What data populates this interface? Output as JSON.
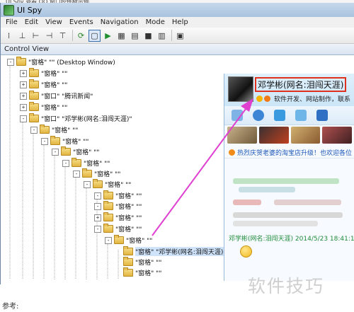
{
  "top_text": "…UI Spy 查看 QQ 窗口控件树示例",
  "window": {
    "title": "UI Spy"
  },
  "menu": [
    "File",
    "Edit",
    "View",
    "Events",
    "Navigation",
    "Mode",
    "Help"
  ],
  "toolbar_icons": [
    "tree-view-icon",
    "parent-icon",
    "first-child-icon",
    "next-sibling-icon",
    "last-child-icon",
    "refresh-icon",
    "highlight-icon",
    "play-icon",
    "record-icon",
    "copy-icon",
    "stop-icon",
    "clear-icon",
    "properties-icon"
  ],
  "panel": {
    "title": "Control View"
  },
  "tree_nodes": [
    {
      "label": "\"窗格\" \"\" (Desktop Window)",
      "expander": "-"
    },
    {
      "label": "\"窗格\" \"\"",
      "expander": "+"
    },
    {
      "label": "\"窗格\" \"\"",
      "expander": "+"
    },
    {
      "label": "\"窗口\" \"腾讯新闻\"",
      "expander": "+"
    },
    {
      "label": "\"窗格\" \"\"",
      "expander": "+"
    },
    {
      "label": "\"窗口\" \"邓学彬(网名:泪闯天涯)\"",
      "expander": "-"
    },
    {
      "label": "\"窗格\" \"\"",
      "expander": "-"
    },
    {
      "label": "\"窗格\" \"\"",
      "expander": "-"
    },
    {
      "label": "\"窗格\" \"\"",
      "expander": "-"
    },
    {
      "label": "\"窗格\" \"\"",
      "expander": "-"
    },
    {
      "label": "\"窗格\" \"\"",
      "expander": "-"
    },
    {
      "label": "\"窗格\" \"\"",
      "expander": "-"
    },
    {
      "label": "\"窗格\" \"\"",
      "expander": "-"
    },
    {
      "label": "\"窗格\" \"\"",
      "expander": "-"
    },
    {
      "label": "\"窗格\" \"\"",
      "expander": "+"
    },
    {
      "label": "\"窗格\" \"\"",
      "expander": "-"
    },
    {
      "label": "\"窗格\" \"\"",
      "expander": "-"
    },
    {
      "label": "\"窗格\" \"邓学彬(网名:泪闯天涯)\"",
      "expander": ""
    },
    {
      "label": "\"窗格\" \"\"",
      "expander": ""
    },
    {
      "label": "\"窗格\" \"\"",
      "expander": ""
    }
  ],
  "qq_chat": {
    "name": "邓学彬(网名:泪闯天涯)",
    "signature": "软件开发、网站制作，联系",
    "notice": "热烈庆贺老婆的淘宝店升级！也欢迎各位",
    "message_meta": "邓学彬(网名:泪闯天涯) 2014/5/23 18:41:1",
    "colors": {
      "highlight": "#e0301e",
      "arrow": "#e040d0",
      "meta": "#1e8a38",
      "notice": "#1c56b8"
    }
  },
  "watermark": "软件技巧",
  "caption": "参考:"
}
